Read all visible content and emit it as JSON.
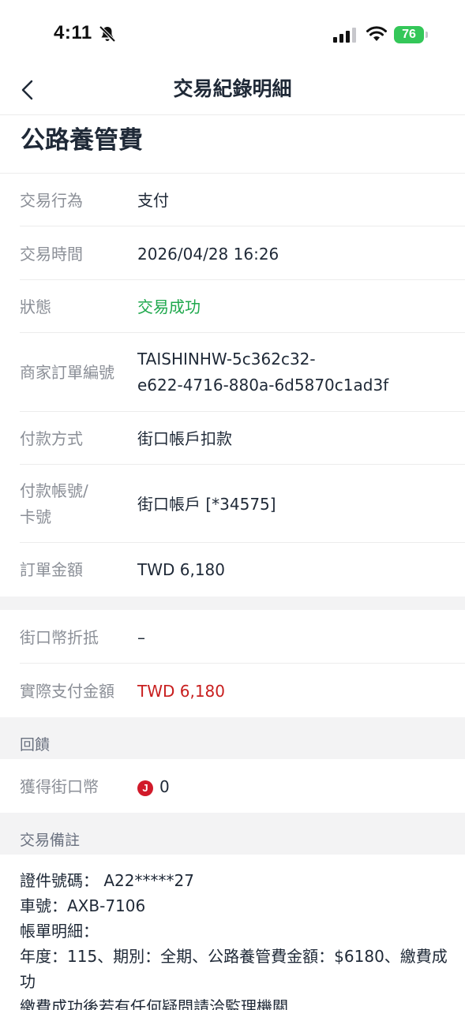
{
  "status_bar": {
    "time": "4:11",
    "battery": "76"
  },
  "nav": {
    "title": "交易紀錄明細"
  },
  "heading": "公路養管費",
  "details": [
    {
      "label": "交易行為",
      "value": "支付"
    },
    {
      "label": "交易時間",
      "value": "2026/04/28 16:26"
    },
    {
      "label": "狀態",
      "value": "交易成功"
    },
    {
      "label": "商家訂單編號",
      "value_line1": "TAISHINHW-5c362c32-",
      "value_line2": "e622-4716-880a-6d5870c1ad3f"
    },
    {
      "label": "付款方式",
      "value": "街口帳戶扣款"
    },
    {
      "label_line1": "付款帳號/",
      "label_line2": "卡號",
      "value": "街口帳戶 [*34575]"
    },
    {
      "label": "訂單金額",
      "value": "TWD 6,180"
    }
  ],
  "payment": [
    {
      "label": "街口幣折抵",
      "value": "–"
    },
    {
      "label": "實際支付金額",
      "value": "TWD 6,180"
    }
  ],
  "feedback": {
    "section": "回饋",
    "label": "獲得街口幣",
    "coin_letter": "J",
    "value": "0"
  },
  "remarks": {
    "section": "交易備註",
    "lines": [
      "證件號碼： A22*****27",
      "車號：AXB-7106",
      "帳單明細：",
      "年度：115、期別：全期、公路養管費金額：$6180、繳費成功",
      "繳費成功後若有任何疑問請洽監理機關"
    ]
  },
  "colors": {
    "success": "#1ea84c",
    "amount_red": "#c81e1e",
    "battery_green": "#34c759"
  }
}
